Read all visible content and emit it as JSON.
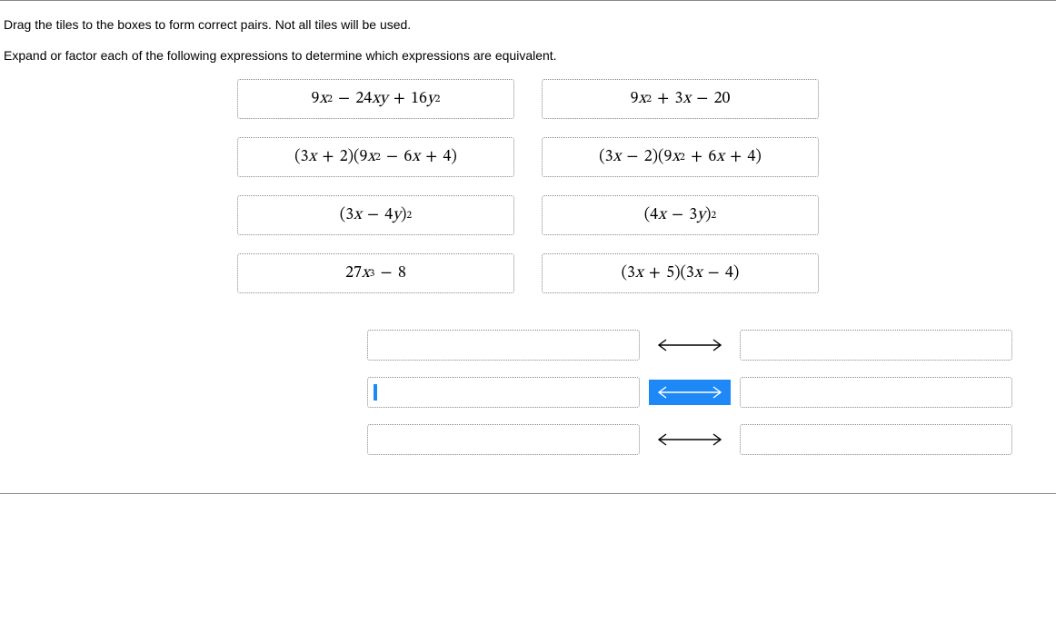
{
  "instructions": {
    "line1": "Drag the tiles to the boxes to form correct pairs. Not all tiles will be used.",
    "line2": "Expand or factor each of the following expressions to determine which expressions are equivalent."
  },
  "tiles": {
    "tile_1": "9x² − 24xy + 16y²",
    "tile_2": "9x² + 3x − 20",
    "tile_3": "(3x + 2)(9x² − 6x + 4)",
    "tile_4": "(3x − 2)(9x² + 6x + 4)",
    "tile_5": "(3x − 4y)²",
    "tile_6": "(4x − 3y)²",
    "tile_7": "27x³ − 8",
    "tile_8": "(3x + 5)(3x − 4)"
  }
}
